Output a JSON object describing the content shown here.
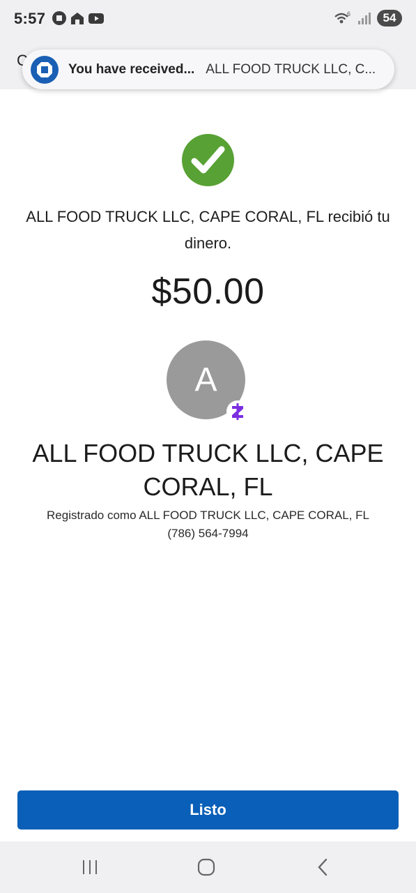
{
  "status_bar": {
    "time": "5:57",
    "signal_label": "6",
    "battery": "54"
  },
  "header": {
    "partial_title": "C"
  },
  "notification": {
    "title": "You have received...",
    "text": "ALL FOOD TRUCK LLC, C..."
  },
  "confirmation": {
    "icon": "check-circle-icon",
    "message": "ALL FOOD TRUCK LLC, CAPE CORAL, FL recibió tu dinero.",
    "amount": "$50.00"
  },
  "recipient": {
    "avatar_initial": "A",
    "name": "ALL FOOD TRUCK LLC, CAPE CORAL, FL",
    "registered_as": "Registrado como ALL FOOD TRUCK LLC, CAPE CORAL, FL",
    "phone": "(786) 564-7994",
    "badge_icon": "zelle-icon"
  },
  "actions": {
    "done_label": "Listo"
  },
  "nav": {
    "recent_icon": "recent-apps-icon",
    "home_icon": "home-icon",
    "back_icon": "back-icon"
  },
  "colors": {
    "success_green": "#58a134",
    "button_blue": "#0a5fb8",
    "zelle_purple": "#7a2ee0",
    "avatar_gray": "#9a9a9a"
  }
}
